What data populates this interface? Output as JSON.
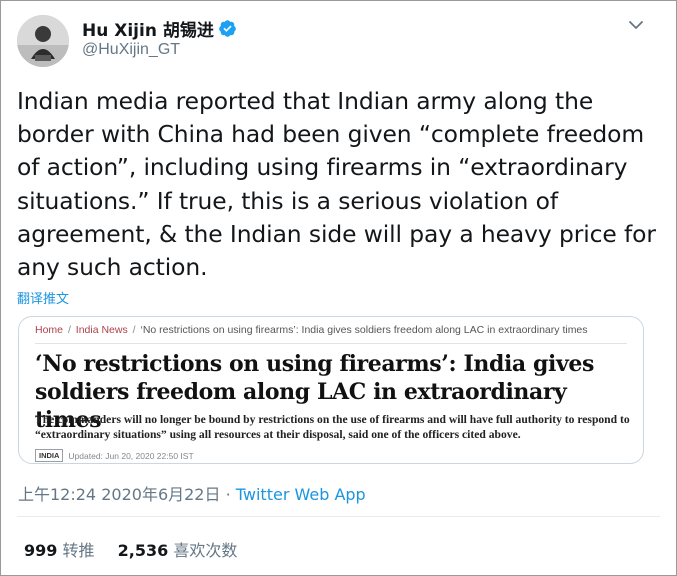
{
  "author": {
    "display_name": "Hu Xijin 胡锡进",
    "handle": "@HuXijin_GT",
    "verified": true
  },
  "tweet": {
    "text": "Indian media reported that Indian army along the border with China had been given “complete freedom of action”, including using firearms in “extraordinary situations.” If true, this is a serious violation of agreement, & the Indian side will pay a heavy price for any such action.",
    "translate_label": "翻译推文",
    "time": "上午12:24",
    "date": "2020年6月22日",
    "separator": "·",
    "source_app": "Twitter Web App"
  },
  "card": {
    "breadcrumb": [
      "Home",
      "India News",
      "‘No restrictions on using firearms’: India gives soldiers freedom along LAC in extraordinary times"
    ],
    "breadcrumb_sep": "/",
    "headline": "‘No restrictions on using firearms’: India gives soldiers freedom along LAC in extraordinary times",
    "summary": "The commanders will no longer be bound by restrictions on the use of firearms and will have full authority to respond to “extraordinary situations” using all resources at their disposal, said one of the officers cited above.",
    "tag": "INDIA",
    "updated": "Updated: Jun 20, 2020 22:50 IST"
  },
  "stats": {
    "retweets_count": "999",
    "retweets_label": "转推",
    "likes_count": "2,536",
    "likes_label": "喜欢次数"
  },
  "icons": {
    "verified": "verified-badge-icon",
    "menu": "chevron-down-icon"
  },
  "colors": {
    "link": "#1b95e0",
    "muted": "#657786",
    "verified": "#1da1f2"
  }
}
